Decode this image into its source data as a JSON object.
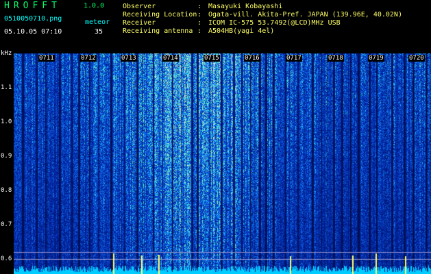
{
  "header": {
    "app_title": "HROFFT",
    "app_version": "1.0.0",
    "file_name": "0510050710.png",
    "timestamp": "05.10.05 07:10",
    "meteor_label": "meteor",
    "meteor_count": "35"
  },
  "info": [
    {
      "label": "Observer",
      "value": "Masayuki Kobayashi"
    },
    {
      "label": "Receiving Location",
      "value": "Ogata-vill. Akita-Pref. JAPAN (139.96E, 40.02N)"
    },
    {
      "label": "Receiver",
      "value": "ICOM IC-575 53.7492(@LCD)MHz USB"
    },
    {
      "label": "Receiving antenna",
      "value": "A504HB(yagi 4el)"
    }
  ],
  "separator": ":",
  "chart_data": {
    "type": "heatmap",
    "ylabel": "kHz",
    "y_ticks": [
      "1.1",
      "1.0",
      "0.9",
      "0.8",
      "0.7",
      "0.6"
    ],
    "x_ticks": [
      "0711",
      "0712",
      "0713",
      "0714",
      "0715",
      "0716",
      "0717",
      "0718",
      "0719",
      "0720"
    ],
    "ylim": [
      0.57,
      1.18
    ],
    "colors": {
      "background": "#000000",
      "low": "#0a1a8a",
      "mid": "#2a5cff",
      "high": "#7fffd4",
      "marker": "#ffff66"
    }
  }
}
